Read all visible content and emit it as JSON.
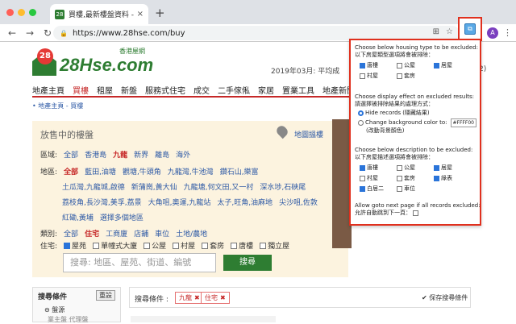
{
  "browser": {
    "tab_title": "買樓,最新樓盤資料 - 28Hse 香港",
    "tab_close": "×",
    "new_tab": "+",
    "url": "https://www.28hse.com/buy",
    "back": "←",
    "forward": "→",
    "reload": "↻",
    "avatar_letter": "A",
    "extension_glyph": "⧉",
    "colors": {
      "red": "#ff5f57",
      "yellow": "#febc2e",
      "green": "#28c840"
    }
  },
  "site": {
    "logo_badge": "28",
    "logo_name": "28Hse.com",
    "logo_tag": "香港屋網",
    "date_text": "2019年03月: 平均成",
    "date_tail": "2)",
    "nav": [
      "地產主頁",
      "買樓",
      "租屋",
      "新盤",
      "服務式住宅",
      "成交",
      "二手傢俬",
      "家居",
      "置業工具",
      "地產新聞",
      "幫助"
    ],
    "active_nav": 1,
    "breadcrumb": "• 地產主頁 - 買樓"
  },
  "filter": {
    "title": "放售中的樓盤",
    "map_link": "地圖搵樓",
    "area_label": "區域:",
    "areas": [
      "全部",
      "香港島",
      "九龍",
      "新界",
      "離島",
      "海外"
    ],
    "selected_area": 2,
    "district_label": "地區:",
    "districts_row1": [
      "全部",
      "藍田,油塘",
      "觀塘,牛頭角",
      "九龍灣,牛池灣",
      "鑽石山,樂富"
    ],
    "districts_row2": [
      "土瓜灣,九龍城,啟德",
      "新蒲崗,黃大仙",
      "九龍塘,何文田,又一村",
      "深水埗,石硤尾"
    ],
    "districts_row3": [
      "荔枝角,長沙灣,美孚,荔景",
      "大角咀,奧運,九龍站",
      "太子,旺角,油麻地",
      "尖沙咀,佐敦"
    ],
    "districts_row4": [
      "紅磡,黃埔",
      "選擇多個地區"
    ],
    "type_label": "類別:",
    "types": [
      "全部",
      "住宅",
      "工商廈",
      "店舖",
      "車位",
      "土地/農地"
    ],
    "selected_type": 1,
    "residence_label": "住宅:",
    "residence_options": [
      {
        "label": "屋苑",
        "checked": true
      },
      {
        "label": "單幢式大廈",
        "checked": false
      },
      {
        "label": "公屋",
        "checked": false
      },
      {
        "label": "村屋",
        "checked": false
      },
      {
        "label": "套房",
        "checked": false
      },
      {
        "label": "唐樓",
        "checked": false
      },
      {
        "label": "獨立屋",
        "checked": false
      }
    ],
    "search_placeholder": "搜尋: 地區、屋苑、街道、編號",
    "search_button": "搜尋"
  },
  "bottom": {
    "side_title": "搜尋條件",
    "reset": "重設",
    "side_sub": "⊖ 盤源",
    "side_sub2": "業主盤  代理盤",
    "criteria_label": "搜尋條件 :",
    "chips": [
      "九龍",
      "住宅"
    ],
    "save_search": "✔ 保存搜尋條件"
  },
  "popup": {
    "s1_en": "Choose below housing type to be excluded:",
    "s1_zh": "以下房屋類型選項將會被排除：",
    "s1_items": [
      {
        "label": "唐樓",
        "checked": true
      },
      {
        "label": "公屋",
        "checked": false
      },
      {
        "label": "居屋",
        "checked": true
      },
      {
        "label": "村屋",
        "checked": false
      },
      {
        "label": "套房",
        "checked": false
      }
    ],
    "s2_en": "Choose display effect on excluded results:",
    "s2_zh": "請選擇被排除結果的處理方式：",
    "s2_opt1": "Hide records",
    "s2_opt1_zh": "(隱藏結果)",
    "s2_opt2": "Change background color to:",
    "s2_color": "#FFFF00",
    "s2_opt2_zh": "(改動背景顏色)",
    "s3_en": "Choose below description to be excluded:",
    "s3_zh": "以下房屋描述選項將會被排除：",
    "s3_items": [
      {
        "label": "唐樓",
        "checked": true
      },
      {
        "label": "公屋",
        "checked": false
      },
      {
        "label": "居屋",
        "checked": true
      },
      {
        "label": "村屋",
        "checked": false
      },
      {
        "label": "套房",
        "checked": false
      },
      {
        "label": "綠表",
        "checked": true
      },
      {
        "label": "白居二",
        "checked": true
      },
      {
        "label": "車位",
        "checked": false
      }
    ],
    "s4_en": "Allow goto next page if all records excluded:",
    "s4_zh": "允許自動跳到下一頁："
  }
}
